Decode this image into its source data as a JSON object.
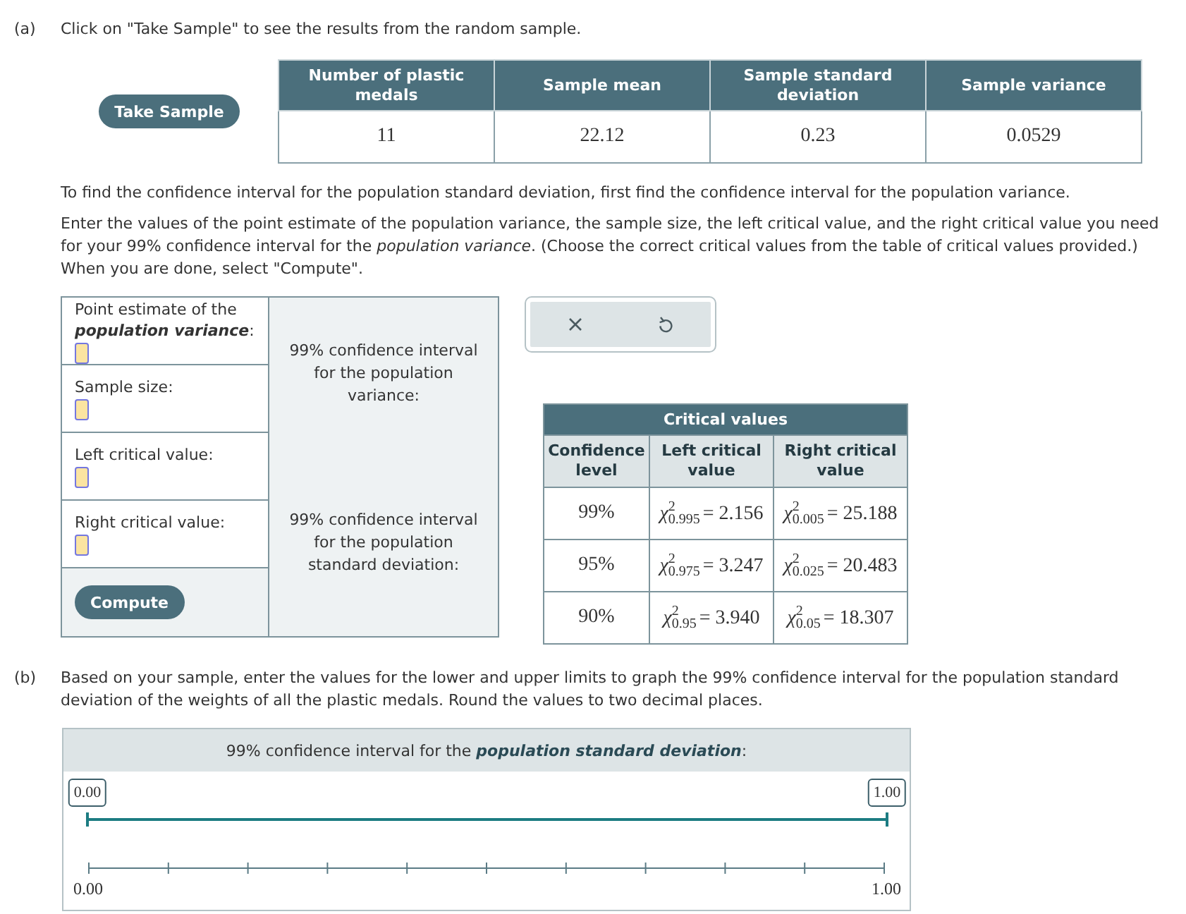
{
  "part_a": {
    "label": "(a)",
    "instruction": "Click on \"Take Sample\" to see the results from the random sample.",
    "take_sample_button": "Take Sample",
    "results_table": {
      "columns": [
        "Number of plastic medals",
        "Sample mean",
        "Sample standard deviation",
        "Sample variance"
      ],
      "values": [
        "11",
        "22.12",
        "0.23",
        "0.0529"
      ]
    },
    "paragraphs": [
      "To find the confidence interval for the population standard deviation, first find the confidence interval for the population variance.",
      "Enter the values of the point estimate of the population variance, the sample size, the left critical value, and the right critical value you need for your 99% confidence interval for the *population variance*. (Choose the correct critical values from the table of critical values provided.) When you are done, select \"Compute\"."
    ],
    "form": {
      "fields": [
        {
          "label": "Point estimate of the **population variance**:"
        },
        {
          "label": "Sample size:"
        },
        {
          "label": "Left critical value:"
        },
        {
          "label": "Right critical value:"
        }
      ],
      "compute_button": "Compute",
      "results": [
        "99% confidence interval for the population variance:",
        "99% confidence interval for the population standard deviation:"
      ]
    },
    "critical_values": {
      "title": "Critical values",
      "columns": [
        "Confidence level",
        "Left critical value",
        "Right critical value"
      ],
      "rows": [
        {
          "confidence": "99%",
          "left": {
            "symbol": "χ",
            "superscript": "2",
            "subscript": "0.995",
            "value": "= 2.156"
          },
          "right": {
            "symbol": "χ",
            "superscript": "2",
            "subscript": "0.005",
            "value": "= 25.188"
          }
        },
        {
          "confidence": "95%",
          "left": {
            "symbol": "χ",
            "superscript": "2",
            "subscript": "0.975",
            "value": "= 3.247"
          },
          "right": {
            "symbol": "χ",
            "superscript": "2",
            "subscript": "0.025",
            "value": "= 20.483"
          }
        },
        {
          "confidence": "90%",
          "left": {
            "symbol": "χ",
            "superscript": "2",
            "subscript": "0.95",
            "value": "= 3.940"
          },
          "right": {
            "symbol": "χ",
            "superscript": "2",
            "subscript": "0.05",
            "value": "= 18.307"
          }
        }
      ]
    }
  },
  "part_b": {
    "label": "(b)",
    "instruction": "Based on your sample, enter the values for the lower and upper limits to graph the 99% confidence interval for the population standard deviation of the weights of all the plastic medals. Round the values to two decimal places.",
    "number_line": {
      "title": "99% confidence interval for the **population standard deviation**:",
      "lower": {
        "value": "0.00",
        "level": 0
      },
      "upper": {
        "value": "1.00",
        "level": 1
      },
      "axis_labels": [
        "0.00",
        "1.00"
      ]
    }
  }
}
